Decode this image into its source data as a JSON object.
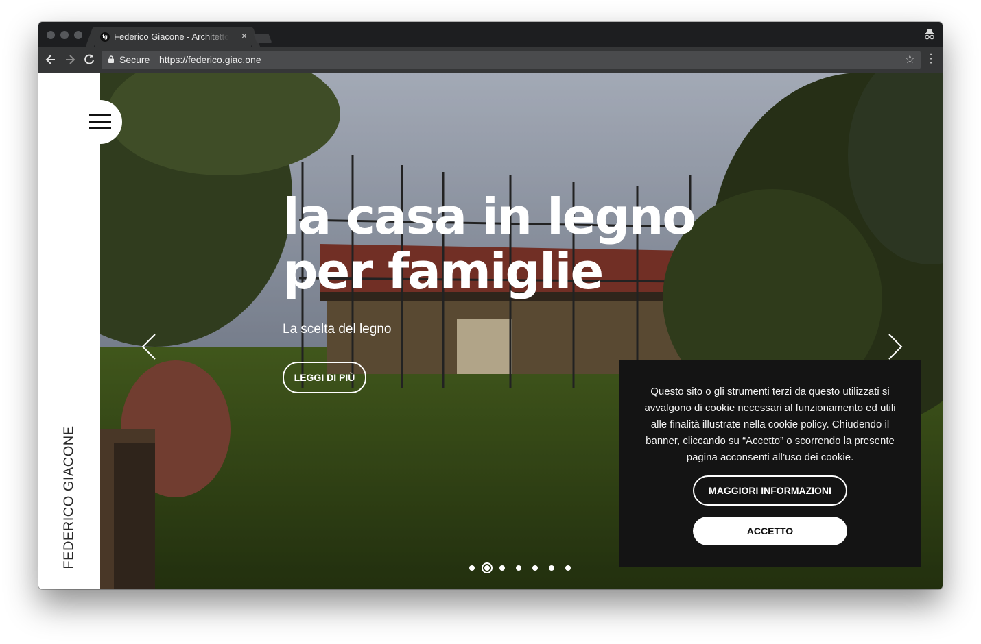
{
  "browser": {
    "tab_title": "Federico Giacone - Architetto",
    "tab_favicon_text": "fg",
    "tab_close": "×",
    "secure_label": "Secure",
    "url": "https://federico.giac.one"
  },
  "sidebar": {
    "brand": "FEDERICO GIACONE"
  },
  "hero": {
    "headline_line1": "la casa in legno",
    "headline_line2": "per famiglie",
    "subtitle": "La scelta del legno",
    "cta_label": "LEGGI DI PIÙ",
    "slide_count": 7,
    "active_slide": 2
  },
  "cookie_banner": {
    "text": "Questo sito o gli strumenti terzi da questo utilizzati si avvalgono di cookie necessari al funzionamento ed utili alle finalità illustrate nella cookie policy. Chiudendo il banner, cliccando su “Accetto” o scorrendo la presente pagina acconsenti all’uso dei cookie.",
    "more_label": "MAGGIORI INFORMAZIONI",
    "accept_label": "ACCETTO"
  },
  "icons": {
    "back": "arrow-left-icon",
    "forward": "arrow-right-icon",
    "reload": "reload-icon",
    "lock": "lock-icon",
    "star": "star-icon",
    "menu": "kebab-menu-icon",
    "incognito": "incognito-icon",
    "hamburger": "hamburger-icon"
  }
}
